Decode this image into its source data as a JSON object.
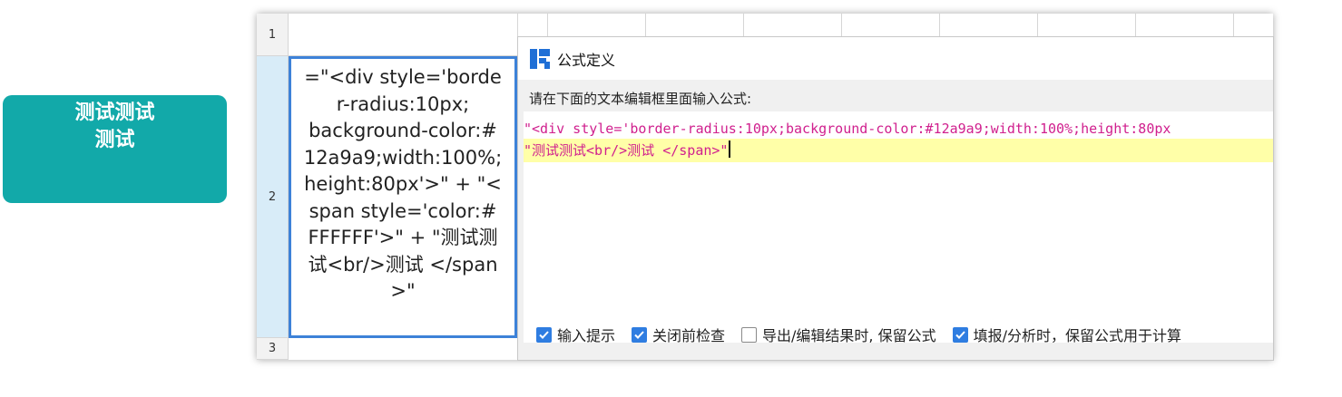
{
  "preview": {
    "line1": "测试测试",
    "line2": "测试",
    "bg_color": "#12a9a9"
  },
  "sheet": {
    "rows": [
      "1",
      "2",
      "3"
    ],
    "cell_text_lines": [
      "=\"<div style='borde",
      "r-radius:10px;",
      "background-color:#",
      "12a9a9;width:100%;",
      "height:80px'>\" + \"<",
      "span style='color:#",
      "FFFFFF'>\" + \"测试测",
      "试<br/>测试 </span",
      ">\""
    ]
  },
  "dialog": {
    "title": "公式定义",
    "prompt": "请在下面的文本编辑框里面输入公式:",
    "code_line1": "\"<div style='border-radius:10px;background-color:#12a9a9;width:100%;height:80px",
    "code_line2": "\"测试测试<br/>测试 </span>\"",
    "options": [
      {
        "label": "输入提示",
        "checked": true
      },
      {
        "label": "关闭前检查",
        "checked": true
      },
      {
        "label": "导出/编辑结果时, 保留公式",
        "checked": false
      },
      {
        "label": "填报/分析时，保留公式用于计算",
        "checked": true
      }
    ]
  }
}
